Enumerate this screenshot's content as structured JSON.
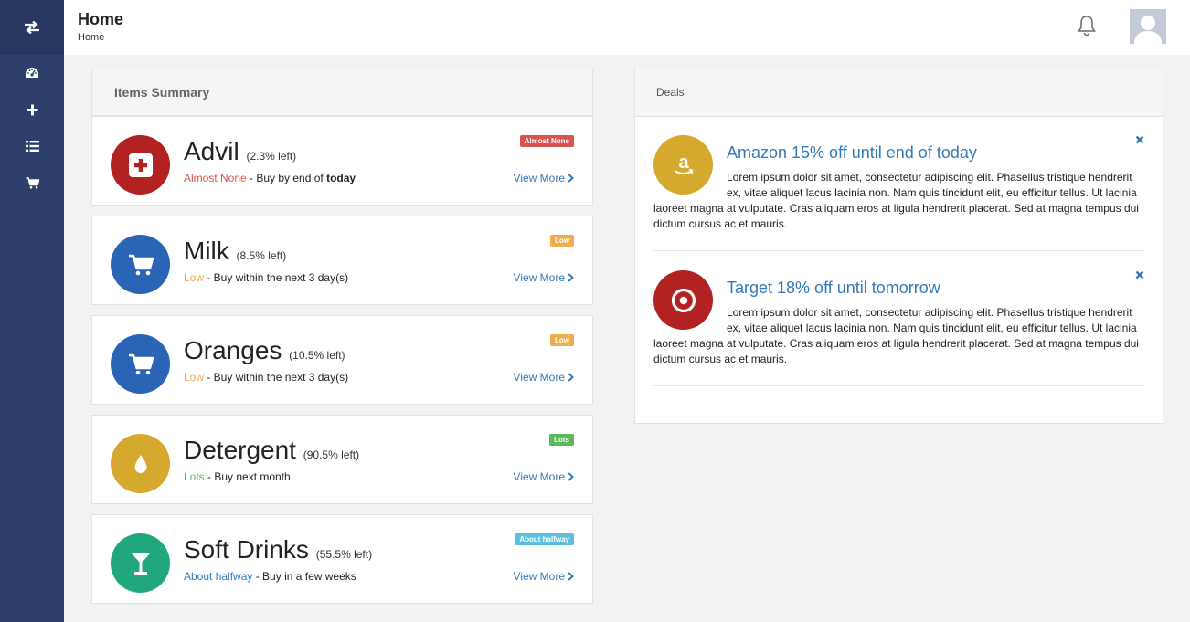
{
  "header": {
    "title": "Home",
    "breadcrumb": "Home"
  },
  "sidebar": {
    "items": [
      {
        "icon": "swap-arrows-icon"
      },
      {
        "icon": "dashboard-icon"
      },
      {
        "icon": "plus-icon"
      },
      {
        "icon": "list-icon"
      },
      {
        "icon": "cart-icon"
      }
    ]
  },
  "items_summary": {
    "title": "Items Summary",
    "items": [
      {
        "name": "Advil",
        "percent": "(2.3% left)",
        "badge": "Almost None",
        "status_label": "Almost None",
        "status_text": " - Buy by end of ",
        "status_emphasis": "today",
        "view_more": "View More",
        "color": "#b22222",
        "status_color": "#d9534f",
        "icon": "medical-kit-icon"
      },
      {
        "name": "Milk",
        "percent": "(8.5% left)",
        "badge": "Low",
        "status_label": "Low",
        "status_text": " - Buy within the next 3 day(s)",
        "status_emphasis": "",
        "view_more": "View More",
        "color": "#2a64b5",
        "status_color": "#f0ad4e",
        "icon": "cart-icon"
      },
      {
        "name": "Oranges",
        "percent": "(10.5% left)",
        "badge": "Low",
        "status_label": "Low",
        "status_text": " - Buy within the next 3 day(s)",
        "status_emphasis": "",
        "view_more": "View More",
        "color": "#2a64b5",
        "status_color": "#f0ad4e",
        "icon": "cart-icon"
      },
      {
        "name": "Detergent",
        "percent": "(90.5% left)",
        "badge": "Lots",
        "status_label": "Lots",
        "status_text": " - Buy next month",
        "status_emphasis": "",
        "view_more": "View More",
        "color": "#d4a92e",
        "status_color": "#5cb85c",
        "icon": "droplet-icon"
      },
      {
        "name": "Soft Drinks",
        "percent": "(55.5% left)",
        "badge": "About halfway",
        "status_label": "About halfway",
        "status_text": " - Buy in a few weeks",
        "status_emphasis": "",
        "view_more": "View More",
        "color": "#20a77d",
        "status_color": "#337ab7",
        "badge_color": "#5bc0de",
        "icon": "cocktail-icon"
      }
    ]
  },
  "deals": {
    "title": "Deals",
    "items": [
      {
        "title": "Amazon 15% off until end of today",
        "body": "Lorem ipsum dolor sit amet, consectetur adipiscing elit. Phasellus tristique hendrerit ex, vitae aliquet lacus lacinia non. Nam quis tincidunt elit, eu efficitur tellus. Ut lacinia laoreet magna at vulputate. Cras aliquam eros at ligula hendrerit placerat. Sed at magna tempus dui dictum cursus ac et mauris.",
        "color": "#d4a92e",
        "icon": "amazon-icon"
      },
      {
        "title": "Target 18% off until tomorrow",
        "body": "Lorem ipsum dolor sit amet, consectetur adipiscing elit. Phasellus tristique hendrerit ex, vitae aliquet lacus lacinia non. Nam quis tincidunt elit, eu efficitur tellus. Ut lacinia laoreet magna at vulputate. Cras aliquam eros at ligula hendrerit placerat. Sed at magna tempus dui dictum cursus ac et mauris.",
        "color": "#b22222",
        "icon": "target-icon"
      }
    ]
  },
  "colors": {
    "sidebar": "#2f3f6b",
    "link": "#337ab7",
    "danger": "#d9534f",
    "warning": "#f0ad4e",
    "success": "#5cb85c",
    "info": "#5bc0de"
  }
}
